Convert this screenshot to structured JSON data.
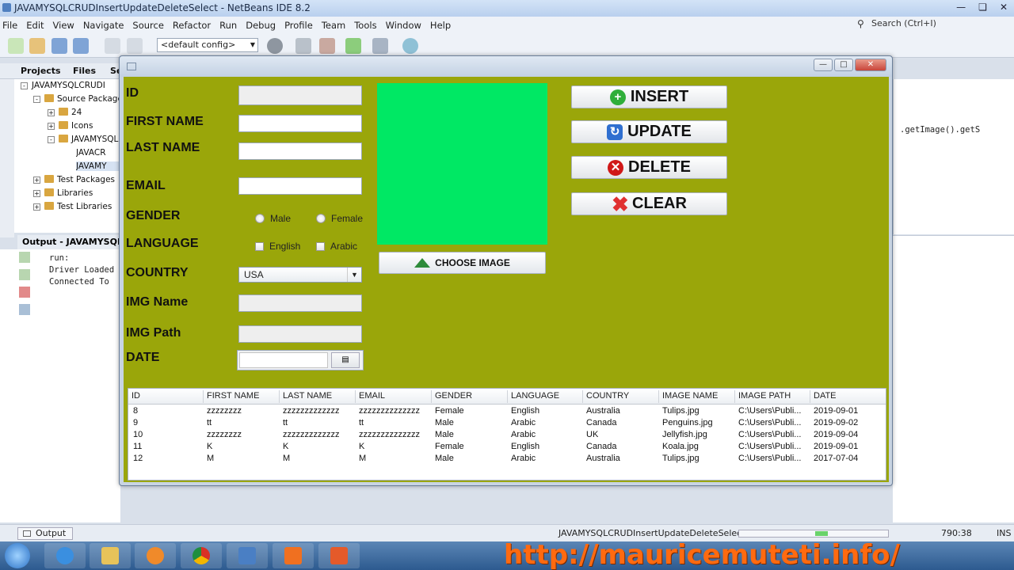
{
  "ide": {
    "title": "JAVAMYSQLCRUDInsertUpdateDeleteSelect - NetBeans IDE 8.2",
    "menu": [
      "File",
      "Edit",
      "View",
      "Navigate",
      "Source",
      "Refactor",
      "Run",
      "Debug",
      "Profile",
      "Team",
      "Tools",
      "Window",
      "Help"
    ],
    "search_placeholder": "Search (Ctrl+I)",
    "config": "<default config>",
    "projects_tab": "Projects",
    "files_tab": "Files",
    "services_tab_partial": "Se",
    "tree": [
      {
        "label": "JAVAMYSQLCRUDI"
      },
      {
        "label": "Source Package"
      },
      {
        "label": "24"
      },
      {
        "label": "Icons"
      },
      {
        "label": "JAVAMYSQLC"
      },
      {
        "label": "JAVACR"
      },
      {
        "label": "JAVAMY"
      },
      {
        "label": "Test Packages"
      },
      {
        "label": "Libraries"
      },
      {
        "label": "Test Libraries"
      }
    ],
    "output_title": "Output - JAVAMYSQLCR",
    "output_lines": [
      "run:",
      "Driver Loaded",
      "Connected To"
    ],
    "editor_code": ".getImage().getS",
    "status_output_button": "Output",
    "status_run": "JAVAMYSQLCRUDInsertUpdateDeleteSelect (run)",
    "status_position": "790:38",
    "status_mode": "INS",
    "watermark": "http://mauricemuteti.info/"
  },
  "form": {
    "labels": {
      "id": "ID",
      "first_name": "FIRST NAME",
      "last_name": "LAST NAME",
      "email": "EMAIL",
      "gender": "GENDER",
      "language": "LANGUAGE",
      "country": "COUNTRY",
      "img_name": "IMG Name",
      "img_path": "IMG Path",
      "date": "DATE"
    },
    "values": {
      "id": "",
      "first_name": "",
      "last_name": "",
      "email": "",
      "img_name": "",
      "img_path": "",
      "date": ""
    },
    "gender_options": [
      "Male",
      "Female"
    ],
    "language_options": [
      "English",
      "Arabic"
    ],
    "country_selected": "USA",
    "choose_image": "CHOOSE IMAGE",
    "image_preview_color": "#00e864"
  },
  "actions": {
    "insert": "INSERT",
    "update": "UPDATE",
    "delete": "DELETE",
    "clear": "CLEAR"
  },
  "table": {
    "columns": [
      "ID",
      "FIRST NAME",
      "LAST NAME",
      "EMAIL",
      "GENDER",
      "LANGUAGE",
      "COUNTRY",
      "IMAGE NAME",
      "IMAGE PATH",
      "DATE"
    ],
    "rows": [
      [
        "8",
        "zzzzzzzz",
        "zzzzzzzzzzzzz",
        "zzzzzzzzzzzzzz",
        "Female",
        "English",
        "Australia",
        "Tulips.jpg",
        "C:\\Users\\Publi...",
        "2019-09-01"
      ],
      [
        "9",
        "tt",
        "tt",
        "tt",
        "Male",
        "Arabic",
        "Canada",
        "Penguins.jpg",
        "C:\\Users\\Publi...",
        "2019-09-02"
      ],
      [
        "10",
        "zzzzzzzz",
        "zzzzzzzzzzzzz",
        "zzzzzzzzzzzzzz",
        "Male",
        "Arabic",
        "UK",
        "Jellyfish.jpg",
        "C:\\Users\\Publi...",
        "2019-09-04"
      ],
      [
        "11",
        "K",
        "K",
        "K",
        "Female",
        "English",
        "Canada",
        "Koala.jpg",
        "C:\\Users\\Publi...",
        "2019-09-01"
      ],
      [
        "12",
        "M",
        "M",
        "M",
        "Male",
        "Arabic",
        "Australia",
        "Tulips.jpg",
        "C:\\Users\\Publi...",
        "2017-07-04"
      ]
    ]
  },
  "colors": {
    "form_background": "#9aa60a",
    "insert_icon": "#2fae3a",
    "update_icon": "#2f6fd0",
    "delete_icon": "#d01818",
    "clear_icon": "#e03030",
    "watermark": "#ff6a10"
  }
}
